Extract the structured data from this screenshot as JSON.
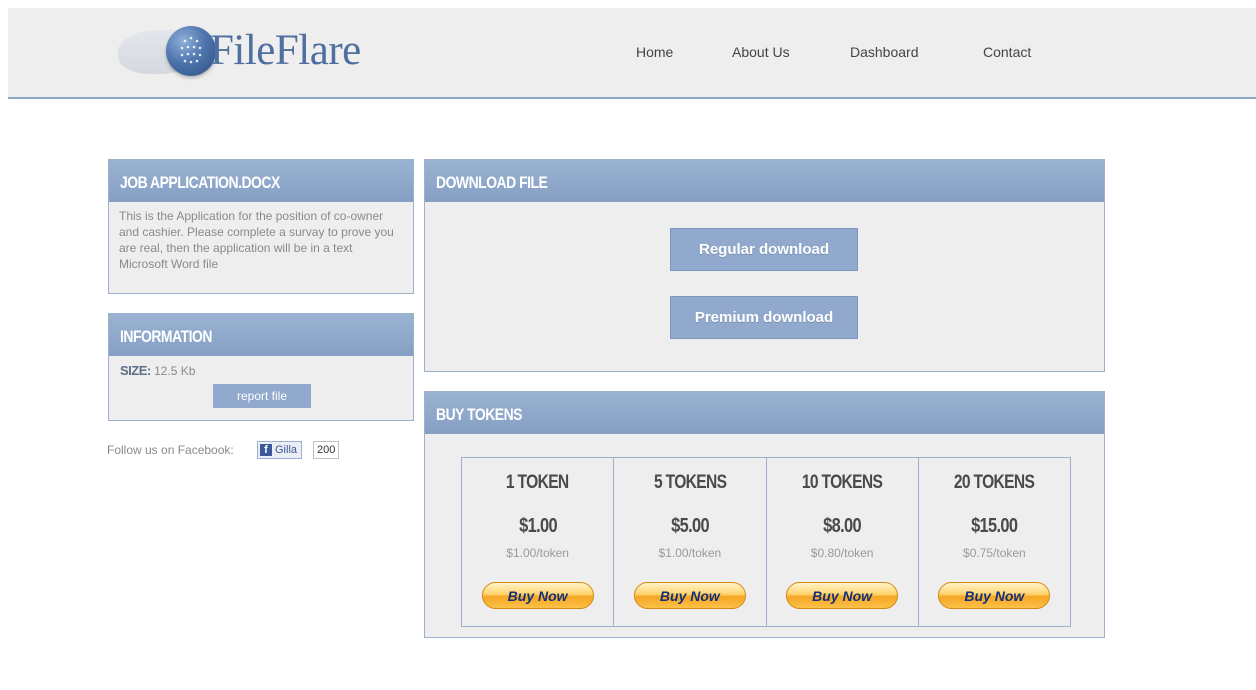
{
  "brand": {
    "name": "FileFlare"
  },
  "nav": [
    {
      "label": "Home"
    },
    {
      "label": "About Us"
    },
    {
      "label": "Dashboard"
    },
    {
      "label": "Contact"
    }
  ],
  "file_panel": {
    "title": "JOB APPLICATION.DOCX",
    "description": "This is the Application for the position of co-owner and cashier. Please complete a survay to prove you are real, then the application will be in a text Microsoft Word file"
  },
  "info_panel": {
    "title": "INFORMATION",
    "size_label": "SIZE:",
    "size_value": "12.5 Kb",
    "report_label": "report file"
  },
  "facebook": {
    "label": "Follow us on Facebook:",
    "like_label": "Gilla",
    "count": "200"
  },
  "download_panel": {
    "title": "DOWNLOAD FILE",
    "regular_label": "Regular download",
    "premium_label": "Premium download"
  },
  "tokens_panel": {
    "title": "BUY TOKENS",
    "buy_label": "Buy Now",
    "options": [
      {
        "name": "1 TOKEN",
        "price": "$1.00",
        "per": "$1.00/token"
      },
      {
        "name": "5 TOKENS",
        "price": "$5.00",
        "per": "$1.00/token"
      },
      {
        "name": "10 TOKENS",
        "price": "$8.00",
        "per": "$0.80/token"
      },
      {
        "name": "20 TOKENS",
        "price": "$15.00",
        "per": "$0.75/token"
      }
    ]
  },
  "colors": {
    "header_bg": "#eeeeee",
    "accent": "#90a9cc",
    "panel_head": "#8fa7c8",
    "buy_button": "#fbc14a"
  }
}
